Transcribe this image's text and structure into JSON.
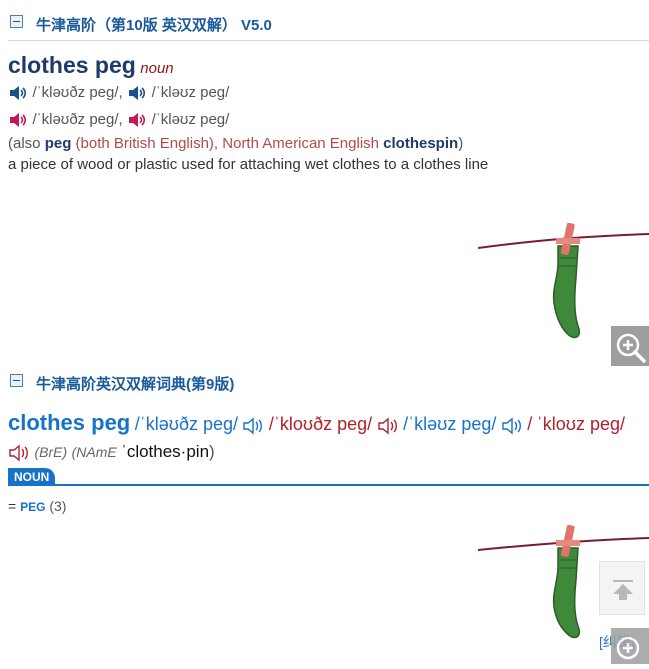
{
  "oxford10": {
    "title": "牛津高阶（第10版 英汉双解） V5.0",
    "headword": "clothes peg",
    "pos": "noun",
    "pron_bre": [
      "/ˈkləʊðz peɡ/,",
      "/ˈkləʊz peɡ/"
    ],
    "pron_name": [
      "/ˈkləʊðz peɡ/,",
      "/ˈkləʊz peɡ/"
    ],
    "also_open": "(also ",
    "also_peg": "peg",
    "also_both": " (both British English), ",
    "also_name": "North American English ",
    "also_clothespin": "clothespin",
    "also_close": ")",
    "definition": "a piece of wood or plastic used for attaching wet clothes to a clothes line"
  },
  "oxford9": {
    "title": "牛津高阶英汉双解词典(第9版)",
    "headword": "clothes peg",
    "pron1": "/ˈkləʊðz peɡ/",
    "pron2": "/ˈkloʊðz peɡ/",
    "pron3": "/ˈkləʊz peɡ/",
    "pron4": "/",
    "pron5": "ˈkloʊz peɡ/",
    "label_bre": "(BrE)",
    "label_name": "(NAmE",
    "alt_form": "ˈclothes·pin",
    "alt_close": ")",
    "noun_tab": "NOUN",
    "eq": "= ",
    "xref": "PEG",
    "xref_num": "(3)"
  },
  "feedback_link": "[纠错]",
  "icons": [
    "collapse-icon",
    "speaker-icon",
    "zoom-in-icon",
    "back-to-top-icon"
  ],
  "colors": {
    "british": "#1d4f8a",
    "american": "#b0222d",
    "brand_blue": "#1673c8"
  }
}
